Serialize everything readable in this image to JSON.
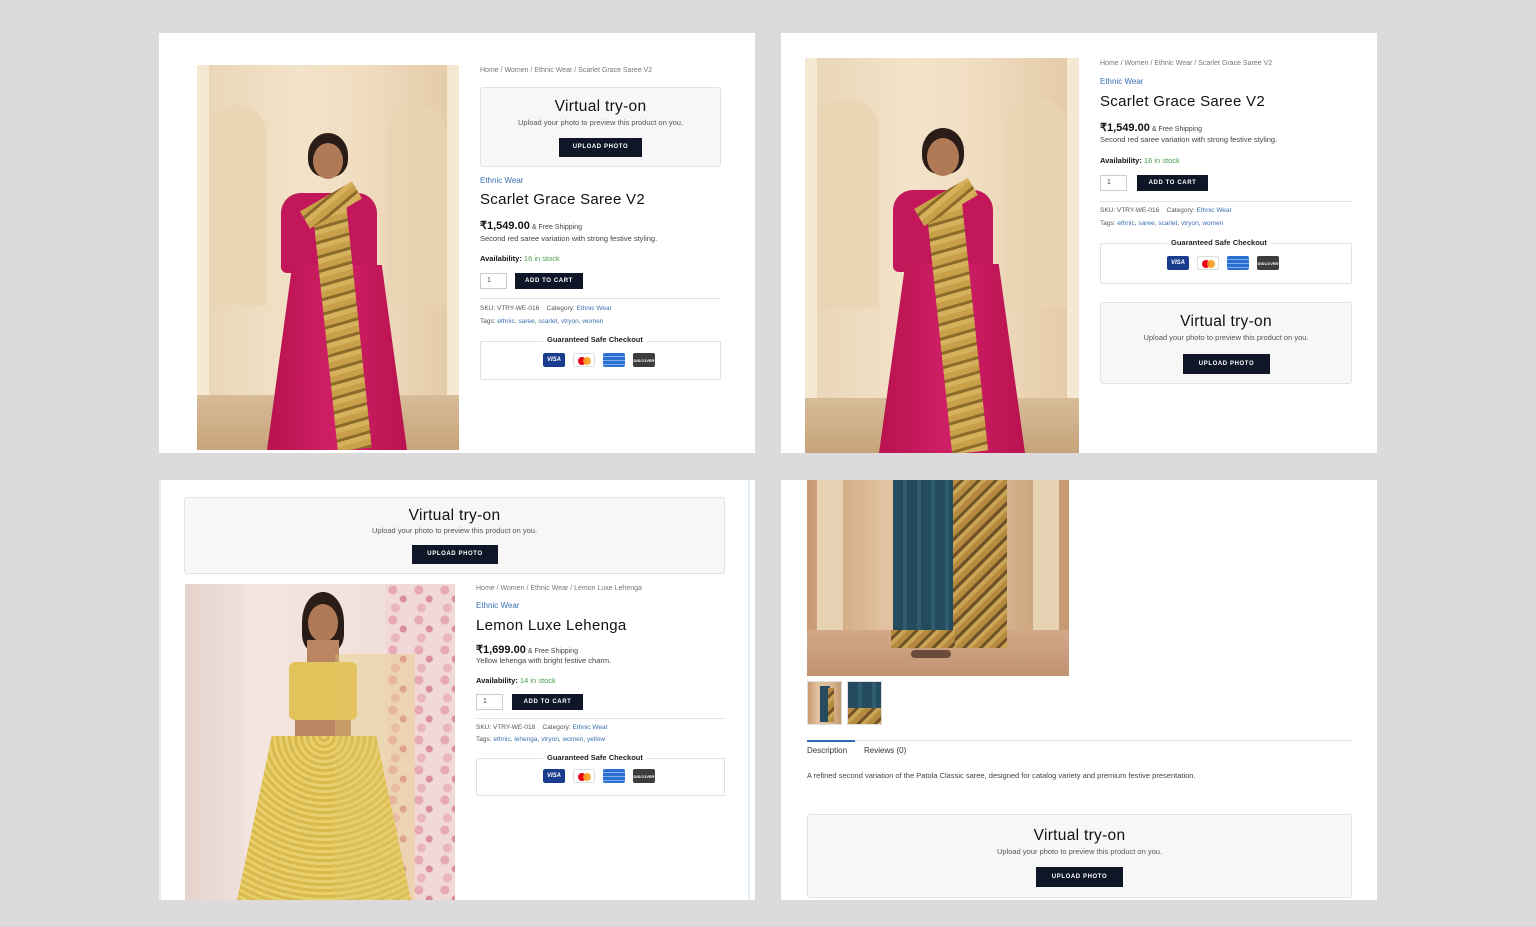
{
  "panels": {
    "p1": {
      "breadcrumb": "Home / Women / Ethnic Wear / Scarlet Grace Saree V2",
      "tryon": {
        "title": "Virtual try-on",
        "subtitle": "Upload your photo to preview this product on you.",
        "button": "UPLOAD PHOTO"
      },
      "category": "Ethnic Wear",
      "title": "Scarlet Grace Saree V2",
      "price": "₹1,549.00",
      "shipping": "& Free Shipping",
      "description": "Second red saree variation with strong festive styling.",
      "availability_label": "Availability:",
      "availability_value": "16 in stock",
      "quantity": "1",
      "add_to_cart": "ADD TO CART",
      "sku_label": "SKU:",
      "sku": "VTRY-WE-016",
      "category_label": "Category:",
      "tags_label": "Tags:",
      "tags": [
        "ethnic",
        "saree",
        "scarlet",
        "vtryon",
        "women"
      ],
      "safe_checkout": "Guaranteed Safe Checkout"
    },
    "p2": {
      "breadcrumb": "Home / Women / Ethnic Wear / Scarlet Grace Saree V2",
      "category": "Ethnic Wear",
      "title": "Scarlet Grace Saree V2",
      "price": "₹1,549.00",
      "shipping": "& Free Shipping",
      "description": "Second red saree variation with strong festive styling.",
      "availability_label": "Availability:",
      "availability_value": "16 in stock",
      "quantity": "1",
      "add_to_cart": "ADD TO CART",
      "sku_label": "SKU:",
      "sku": "VTRY-WE-016",
      "category_label": "Category:",
      "tags_label": "Tags:",
      "tags": [
        "ethnic",
        "saree",
        "scarlet",
        "vtryon",
        "women"
      ],
      "safe_checkout": "Guaranteed Safe Checkout",
      "tryon": {
        "title": "Virtual try-on",
        "subtitle": "Upload your photo to preview this product on you.",
        "button": "UPLOAD PHOTO"
      }
    },
    "p3": {
      "tryon": {
        "title": "Virtual try-on",
        "subtitle": "Upload your photo to preview this product on you.",
        "button": "UPLOAD PHOTO"
      },
      "breadcrumb": "Home / Women / Ethnic Wear / Lemon Luxe Lehenga",
      "category": "Ethnic Wear",
      "title": "Lemon Luxe Lehenga",
      "price": "₹1,699.00",
      "shipping": "& Free Shipping",
      "description": "Yellow lehenga with bright festive charm.",
      "availability_label": "Availability:",
      "availability_value": "14 in stock",
      "quantity": "1",
      "add_to_cart": "ADD TO CART",
      "sku_label": "SKU:",
      "sku": "VTRY-WE-018",
      "category_label": "Category:",
      "tags_label": "Tags:",
      "tags": [
        "ethnic",
        "lehenga",
        "vtryon",
        "women",
        "yellow"
      ],
      "safe_checkout": "Guaranteed Safe Checkout"
    },
    "p4": {
      "tabs": [
        "Description",
        "Reviews (0)"
      ],
      "description_text": "A refined second variation of the Patola Classic saree, designed for catalog variety and premium festive presentation.",
      "tryon": {
        "title": "Virtual try-on",
        "subtitle": "Upload your photo to preview this product on you.",
        "button": "UPLOAD PHOTO"
      }
    }
  },
  "payment_cards": [
    "VISA",
    "mastercard",
    "AMEX",
    "DISCOVER"
  ],
  "colors": {
    "button": "#0e1628",
    "link": "#3a6fb0",
    "in_stock": "#4c9b4c",
    "tab_active": "#2a6fb5",
    "page_bg": "#dcdadb"
  }
}
